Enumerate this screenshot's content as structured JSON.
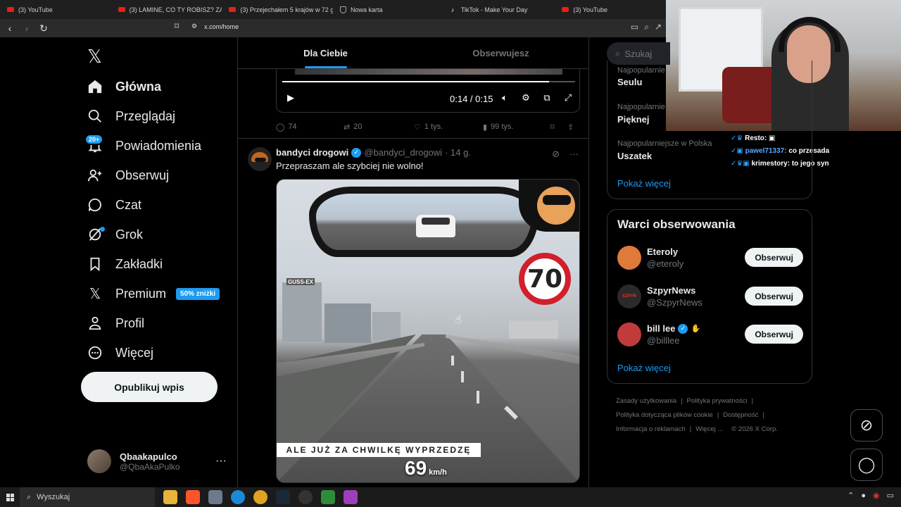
{
  "browser": {
    "tabs": [
      {
        "label": "(3) YouTube",
        "icon": "youtube-icon"
      },
      {
        "label": "(3) LAMINE, CO TY ROBISZ? ZABAW",
        "icon": "youtube-icon"
      },
      {
        "label": "(3) Przejechałem 5 krajów w 72 god",
        "icon": "youtube-icon"
      },
      {
        "label": "Nowa karta",
        "icon": "shield-icon"
      },
      {
        "label": "TikTok - Make Your Day",
        "icon": "tiktok-icon"
      },
      {
        "label": "(3) YouTube",
        "icon": "youtube-icon"
      }
    ],
    "url": "x.com/home"
  },
  "chat": [
    {
      "user": "Resto:",
      "message": "",
      "color": "#ffffff"
    },
    {
      "user": "pawel71337:",
      "message": "co przesada",
      "color": "#5aa9ff"
    },
    {
      "user": "krimestory:",
      "message": "to jego syn",
      "color": "#ffffff"
    }
  ],
  "sidebar": {
    "logo": "𝕏",
    "items": [
      {
        "label": "Główna",
        "icon": "home-icon",
        "active": true
      },
      {
        "label": "Przeglądaj",
        "icon": "search-icon"
      },
      {
        "label": "Powiadomienia",
        "icon": "bell-icon",
        "badge": "20+"
      },
      {
        "label": "Obserwuj",
        "icon": "follow-icon"
      },
      {
        "label": "Czat",
        "icon": "chat-icon"
      },
      {
        "label": "Grok",
        "icon": "grok-icon"
      },
      {
        "label": "Zakładki",
        "icon": "bookmark-icon"
      },
      {
        "label": "Premium",
        "icon": "x-premium-icon",
        "badge": "50% zniżki"
      },
      {
        "label": "Profil",
        "icon": "profile-icon"
      },
      {
        "label": "Więcej",
        "icon": "more-icon"
      }
    ],
    "post_button": "Opublikuj wpis",
    "account": {
      "name": "Qbaakapulco",
      "handle": "@QbaAkaPulko"
    }
  },
  "timeline": {
    "tabs": [
      "Dla Ciebie",
      "Obserwujesz"
    ],
    "video1": {
      "time": "0:14 / 0:15",
      "progress": 0.91
    },
    "tweet1_actions": {
      "replies": "74",
      "reposts": "20",
      "likes": "1 tys.",
      "views": "99 tys."
    },
    "tweet2": {
      "name": "bandyci drogowi",
      "handle": "@bandyci_drogowi",
      "time": "· 14 g.",
      "text": "Przepraszam ale szybciej nie wolno!",
      "video": {
        "sign": "70",
        "caption": "ALE JUŻ ZA CHWILKĘ WYPRZEDZĘ",
        "speed": "69",
        "speed_unit": "km/h",
        "billboard": "GUSS-EX"
      }
    }
  },
  "right": {
    "search_placeholder": "Szukaj",
    "trends": [
      {
        "category": "Najpopularnie",
        "title": "Seulu"
      },
      {
        "category": "Najpopularnie",
        "title": "Pięknej"
      },
      {
        "category": "Najpopularniejsze w Polska",
        "title": "Uszatek"
      }
    ],
    "show_more": "Pokaż więcej",
    "who_to_follow": {
      "title": "Warci obserwowania",
      "accounts": [
        {
          "name": "Eteroly",
          "handle": "@eteroly",
          "button": "Obserwuj",
          "color": "#e07a3a"
        },
        {
          "name": "SzpyrNews",
          "handle": "@SzpyrNews",
          "button": "Obserwuj",
          "color": "#2a2a2a",
          "avatar_text": "SZPYR"
        },
        {
          "name": "bill lee",
          "handle": "@billlee",
          "button": "Obserwuj",
          "color": "#c23b3b",
          "verified": true
        }
      ],
      "show_more": "Pokaż więcej"
    },
    "footer": [
      "Zasady użytkowania",
      "Polityka prywatności",
      "Polityka dotycząca plików cookie",
      "Dostępność",
      "Informacja o reklamach",
      "Więcej ...",
      "© 2026 X Corp."
    ]
  },
  "taskbar": {
    "search": "Wyszukaj"
  },
  "colors": {
    "accent": "#1d9bf0",
    "bg": "#000000",
    "border": "#2f3336",
    "muted": "#71767b"
  }
}
